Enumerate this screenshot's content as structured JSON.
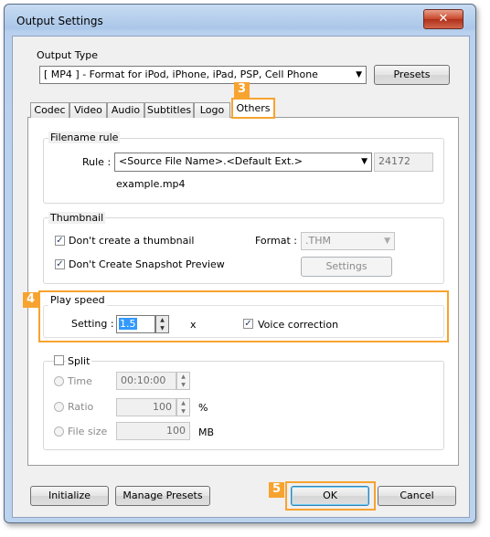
{
  "window": {
    "title": "Output Settings",
    "close_glyph": "✕"
  },
  "output_type": {
    "label": "Output Type",
    "selected": "[ MP4 ] - Format for iPod, iPhone, iPad, PSP, Cell Phone",
    "presets_label": "Presets"
  },
  "tabs": [
    {
      "label": "Codec"
    },
    {
      "label": "Video"
    },
    {
      "label": "Audio"
    },
    {
      "label": "Subtitles"
    },
    {
      "label": "Logo"
    },
    {
      "label": "Others"
    }
  ],
  "badges": {
    "tab_others": "3",
    "play_speed": "4",
    "ok": "5"
  },
  "filename_rule": {
    "label": "Filename rule",
    "rule_label": "Rule :",
    "rule_value": "<Source File Name>.<Default Ext.>",
    "code": "24172",
    "example": "example.mp4"
  },
  "thumbnail": {
    "label": "Thumbnail",
    "dont_create_thumbnail": "Don't create a thumbnail",
    "dont_create_snapshot": "Don't Create Snapshot Preview",
    "format_label": "Format :",
    "format_value": ".THM",
    "settings_label": "Settings"
  },
  "play_speed": {
    "label": "Play speed",
    "setting_label": "Setting :",
    "value": "1.5",
    "unit": "x",
    "voice_correction": "Voice correction"
  },
  "split": {
    "label": "Split",
    "time_label": "Time",
    "time_value": "00:10:00",
    "ratio_label": "Ratio",
    "ratio_value": "100",
    "ratio_unit": "%",
    "filesize_label": "File size",
    "filesize_value": "100",
    "filesize_unit": "MB"
  },
  "footer": {
    "initialize": "Initialize",
    "manage_presets": "Manage Presets",
    "ok": "OK",
    "cancel": "Cancel"
  },
  "colors": {
    "highlight": "#f7a330",
    "selection": "#3399ff"
  }
}
